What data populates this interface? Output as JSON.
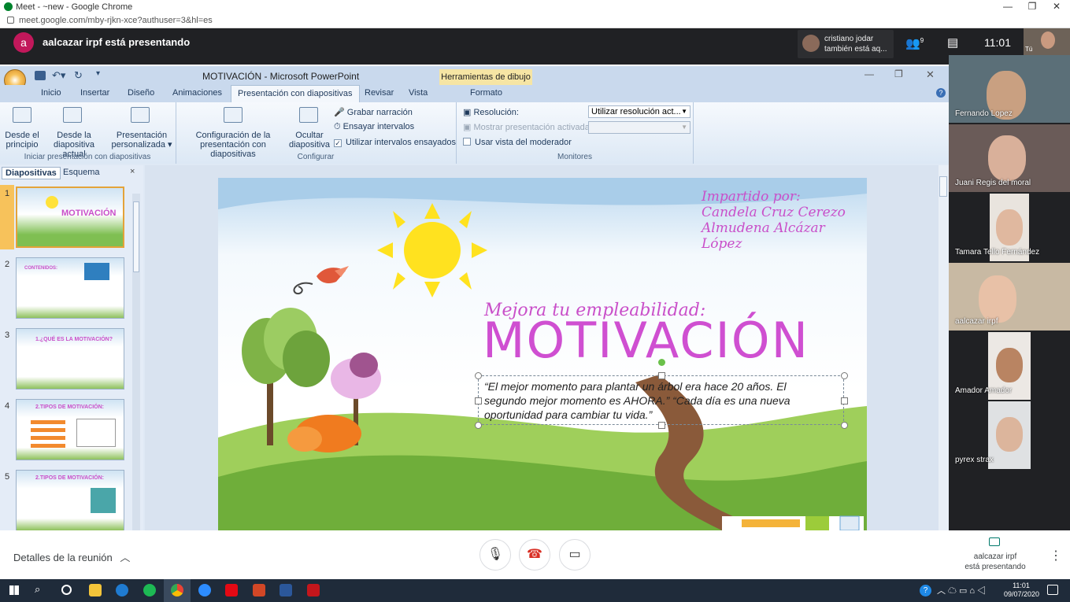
{
  "browser": {
    "title": "Meet - ~new - Google Chrome",
    "url": "meet.google.com/mby-rjkn-xce?authuser=3&hl=es"
  },
  "meet": {
    "avatar_letter": "a",
    "presenting_text": "aalcazar irpf está presentando",
    "notification_line1": "cristiano jodar",
    "notification_line2": "también está aq...",
    "people_count": "9",
    "time": "11:01",
    "self_label": "Tú",
    "meeting_details": "Detalles de la reunión",
    "presenter_line1": "aalcazar irpf",
    "presenter_line2": "está presentando"
  },
  "ppt": {
    "window_title": "MOTIVACIÓN - Microsoft PowerPoint",
    "context_tab": "Herramientas de dibujo",
    "tabs": [
      "Inicio",
      "Insertar",
      "Diseño",
      "Animaciones",
      "Presentación con diapositivas",
      "Revisar",
      "Vista",
      "Formato"
    ],
    "buttons": {
      "desde_principio": "Desde el principio",
      "desde_actual": "Desde la diapositiva actual",
      "personalizada": "Presentación personalizada ▾",
      "configuracion": "Configuración de la presentación con diapositivas",
      "ocultar": "Ocultar diapositiva",
      "grabar": "Grabar narración",
      "ensayar": "Ensayar intervalos",
      "utilizar": "Utilizar intervalos ensayados",
      "resolucion": "Resolución:",
      "resolucion_value": "Utilizar resolución act...",
      "mostrar": "Mostrar presentación activada:",
      "vista_moderador": "Usar vista del moderador"
    },
    "groups": {
      "iniciar": "Iniciar presentación con diapositivas",
      "configurar": "Configurar",
      "monitores": "Monitores"
    },
    "panel_tabs": [
      "Diapositivas",
      "Esquema"
    ],
    "thumbnails": [
      {
        "num": "1",
        "title": "MOTIVACIÓN"
      },
      {
        "num": "2",
        "title": "CONTENIDOS:"
      },
      {
        "num": "3",
        "title": "1.¿QUÉ ES LA MOTIVACIÓN?"
      },
      {
        "num": "4",
        "title": "2.TIPOS DE MOTIVACIÓN:"
      },
      {
        "num": "5",
        "title": "2.TIPOS DE MOTIVACIÓN:"
      }
    ]
  },
  "slide": {
    "credits_line1": "Impartido por:",
    "credits_line2": "Candela Cruz Cerezo",
    "credits_line3": "Almudena Alcázar López",
    "subtitle": "Mejora tu empleabilidad:",
    "title": "MOTIVACIÓN",
    "quote_line1": "“El mejor momento para plantar un árbol era hace 20 años. El",
    "quote_line2": "segundo mejor momento es AHORA.” “Cada día es una nueva",
    "quote_line3": "oportunidad para cambiar tu vida.”"
  },
  "participants": [
    {
      "name": "Fernando Lopez",
      "skin": "#c9a081",
      "bg": "#5b6f78"
    },
    {
      "name": "Juani Regis del moral",
      "skin": "#d9b09a",
      "bg": "#6a5b58"
    },
    {
      "name": "Tamara Tello Fernández",
      "skin": "#e0b89f",
      "bg": "#e9e4de"
    },
    {
      "name": "aalcazar irpf",
      "skin": "#e8c1a7",
      "bg": "#c8b9a3"
    },
    {
      "name": "Amador Amador",
      "skin": "#b98462",
      "bg": "#ece8e4"
    },
    {
      "name": "pyrex strax",
      "skin": "#dcb59c",
      "bg": "#dfe1e3"
    }
  ],
  "taskbar": {
    "time": "11:01",
    "date": "09/07/2020"
  },
  "colors": {
    "meet_dark": "#202124",
    "slide_magenta": "#c94fc9",
    "ppt_blue": "#1e395b",
    "end_call_red": "#d93025"
  }
}
